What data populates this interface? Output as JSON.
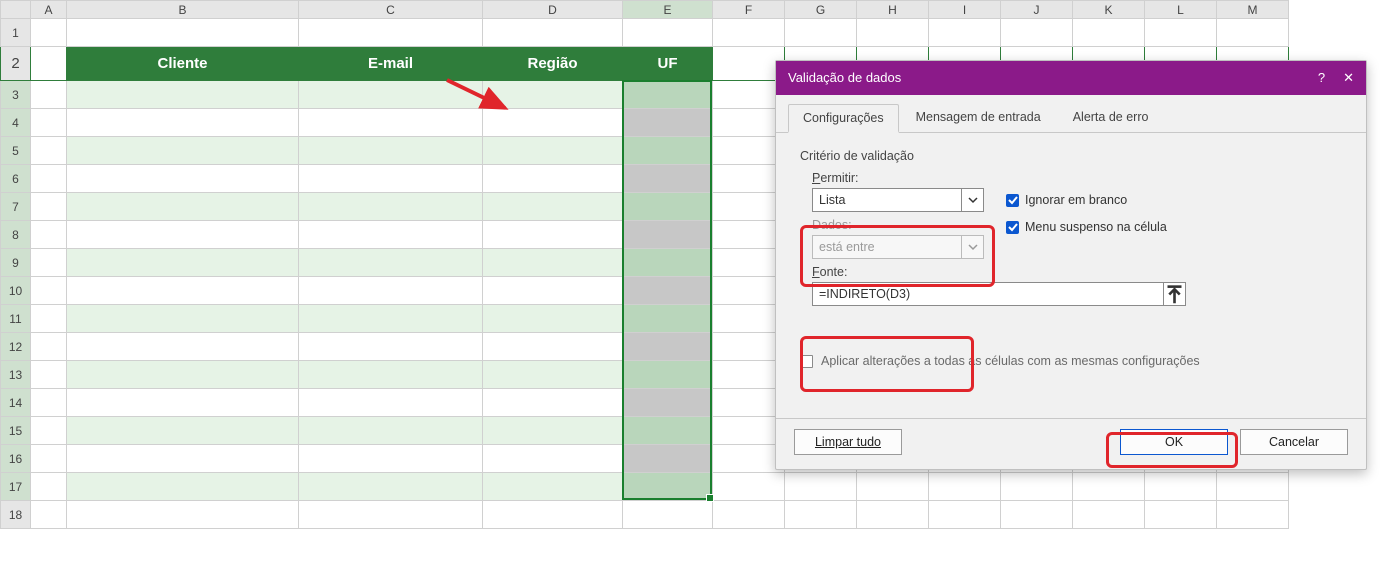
{
  "sheet": {
    "columns": [
      "A",
      "B",
      "C",
      "D",
      "E",
      "F",
      "G",
      "H",
      "I",
      "J",
      "K",
      "L",
      "M"
    ],
    "rows": [
      "1",
      "2",
      "3",
      "4",
      "5",
      "6",
      "7",
      "8",
      "9",
      "10",
      "11",
      "12",
      "13",
      "14",
      "15",
      "16",
      "17",
      "18"
    ],
    "headers": {
      "B": "Cliente",
      "C": "E-mail",
      "D": "Região",
      "E": "UF"
    },
    "selected_column": "E",
    "selected_range": "E3:E17"
  },
  "dialog": {
    "title": "Validação de dados",
    "help_symbol": "?",
    "close_symbol": "✕",
    "tabs": {
      "settings": "Configurações",
      "input_msg": "Mensagem de entrada",
      "error_alert": "Alerta de erro",
      "active": "settings"
    },
    "criteria_title": "Critério de validação",
    "allow": {
      "label_pre": "P",
      "label_rest": "ermitir:",
      "value": "Lista"
    },
    "ignore_blank": {
      "label_pre": "Ignorar em ",
      "label_u": "b",
      "label_post": "ranco",
      "checked": true
    },
    "dropdown_cell": {
      "label_pre": "Menu suspenso na ",
      "label_u": "c",
      "label_post": "élula",
      "checked": true
    },
    "data": {
      "label": "Dados:",
      "value": "está entre"
    },
    "source": {
      "label_pre": "F",
      "label_rest": "onte:",
      "value": "=INDIRETO(D3)"
    },
    "apply_all": "Aplicar alterações a todas as células com as mesmas configurações",
    "buttons": {
      "clear": "Limpar tudo",
      "ok": "OK",
      "cancel": "Cancelar"
    }
  }
}
